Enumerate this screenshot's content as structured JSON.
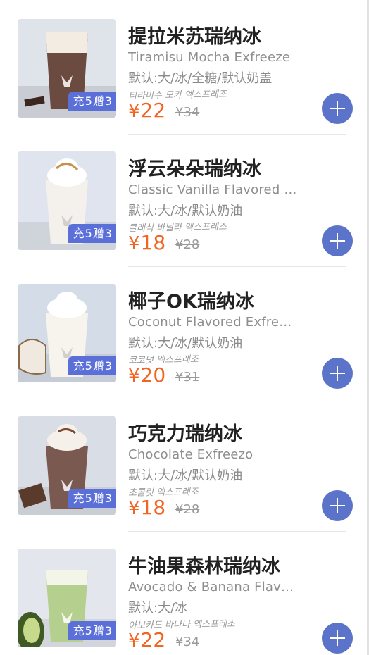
{
  "products": [
    {
      "name_cn": "提拉米苏瑞纳冰",
      "name_en": "Tiramisu Mocha Exfreeze",
      "spec": "默认:大/冰/全糖/默认奶盖",
      "name_ko": "티라미수 모카 엑스프레조",
      "promo": "充5赠3",
      "currency": "¥",
      "price": "22",
      "original_price": "¥34",
      "drink_color": "#6b4a3f",
      "top_color": "#f2ece2"
    },
    {
      "name_cn": "浮云朵朵瑞纳冰",
      "name_en": "Classic Vanilla Flavored Exfreezo",
      "spec": "默认:大/冰/默认奶油",
      "name_ko": "클래식 바닐라 엑스프레조",
      "promo": "充5赠3",
      "currency": "¥",
      "price": "18",
      "original_price": "¥28",
      "drink_color": "#f4f1ec",
      "top_color": "#ffffff"
    },
    {
      "name_cn": "椰子OK瑞纳冰",
      "name_en": "Coconut Flavored Exfreezo",
      "spec": "默认:大/冰/默认奶油",
      "name_ko": "코코넛 엑스프레조",
      "promo": "充5赠3",
      "currency": "¥",
      "price": "20",
      "original_price": "¥31",
      "drink_color": "#f7f4ee",
      "top_color": "#ffffff"
    },
    {
      "name_cn": "巧克力瑞纳冰",
      "name_en": "Chocolate Exfreezo",
      "spec": "默认:大/冰/默认奶油",
      "name_ko": "초콜릿 엑스프레조",
      "promo": "充5赠3",
      "currency": "¥",
      "price": "18",
      "original_price": "¥28",
      "drink_color": "#7a5a50",
      "top_color": "#f5f1ea"
    },
    {
      "name_cn": "牛油果森林瑞纳冰",
      "name_en": "Avocado & Banana Flavored Exfreezo",
      "spec": "默认:大/冰",
      "name_ko": "아보카도 바나나 엑스프레조",
      "promo": "充5赠3",
      "currency": "¥",
      "price": "22",
      "original_price": "¥34",
      "drink_color": "#b5cf8e",
      "top_color": "#f3f5e8"
    }
  ]
}
